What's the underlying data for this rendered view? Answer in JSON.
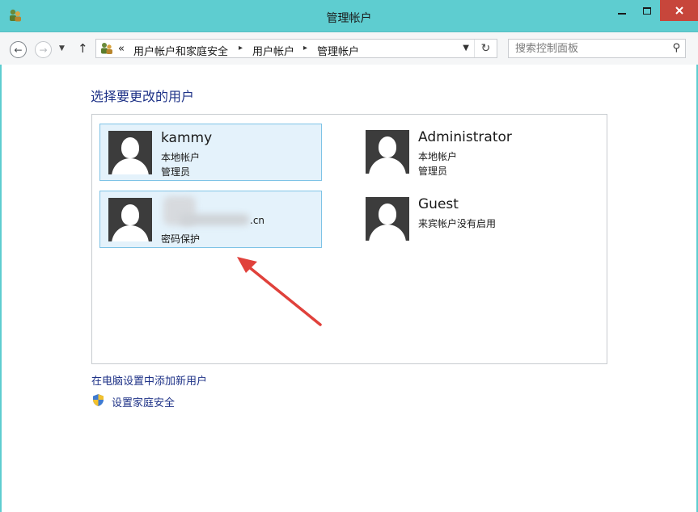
{
  "window": {
    "title": "管理帐户",
    "accent_color": "#5ecdd0",
    "close_color": "#c7463b"
  },
  "navigation": {
    "back_icon": "back-arrow-icon",
    "forward_icon": "forward-arrow-icon",
    "breadcrumb_prefix": "«",
    "breadcrumbs": [
      "用户帐户和家庭安全",
      "用户帐户",
      "管理帐户"
    ],
    "breadcrumb_separator": "▸"
  },
  "search": {
    "placeholder": "搜索控制面板"
  },
  "main": {
    "heading": "选择要更改的用户",
    "accounts": [
      {
        "name": "kammy",
        "line1": "本地帐户",
        "line2": "管理员",
        "selected": true
      },
      {
        "name": "Administrator",
        "line1": "本地帐户",
        "line2": "管理员",
        "selected": false
      },
      {
        "name_suffix": ".cn",
        "line1": "密码保护",
        "selected": true,
        "obscured": true
      },
      {
        "name": "Guest",
        "line1": "来宾帐户没有启用",
        "selected": false
      }
    ],
    "annotation_arrow_color": "#e0413b"
  },
  "links": {
    "add_user": "在电脑设置中添加新用户",
    "family_safety": "设置家庭安全"
  }
}
